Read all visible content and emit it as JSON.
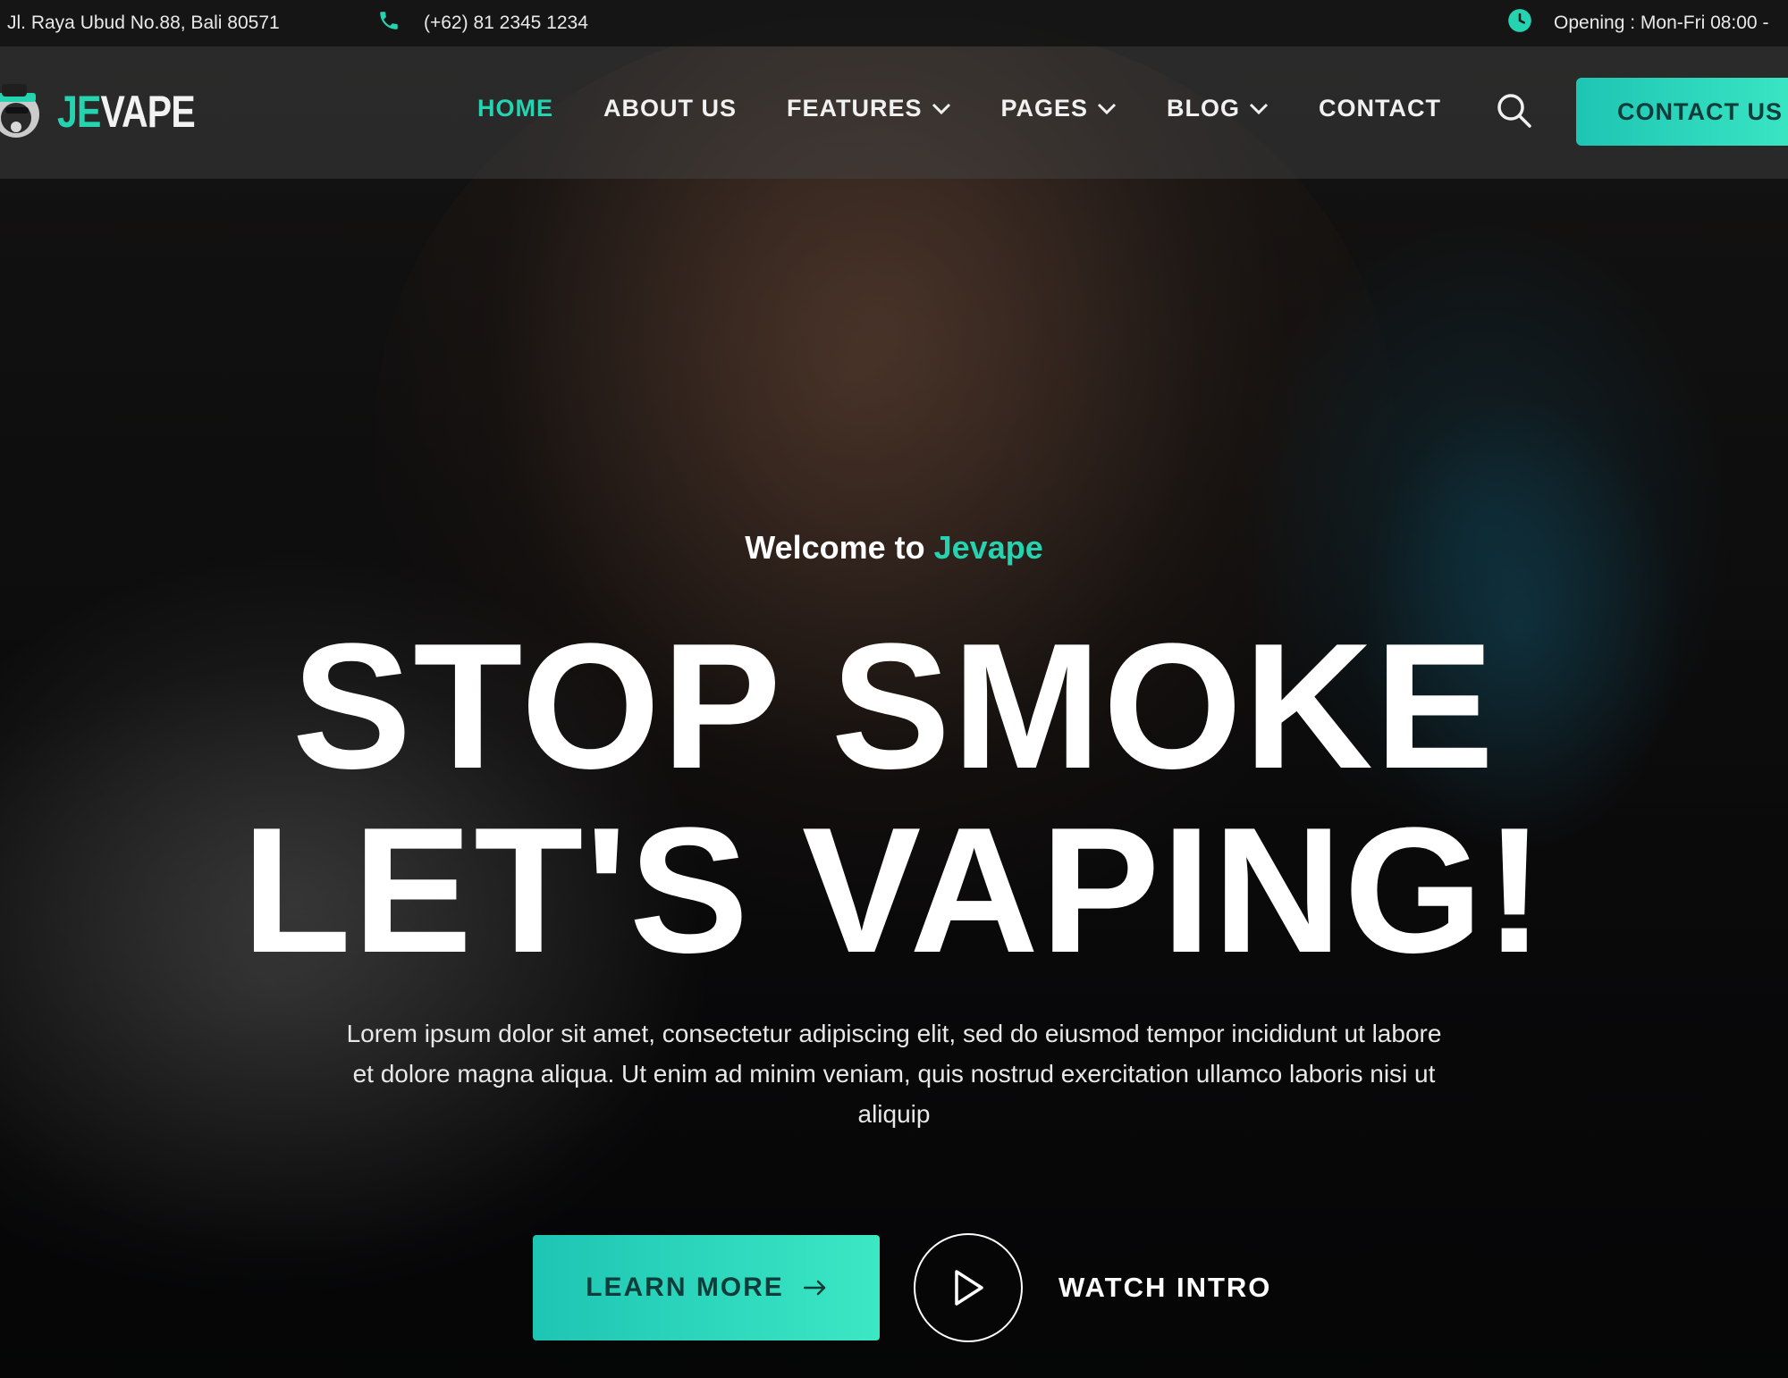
{
  "topbar": {
    "address": "Jl. Raya Ubud No.88, Bali 80571",
    "phone": "(+62) 81 2345 1234",
    "hours": "Opening : Mon-Fri 08:00 -",
    "phone_icon": "phone-icon",
    "clock_icon": "clock-icon"
  },
  "nav": {
    "logo": {
      "accent": "JE",
      "rest": "VAPE"
    },
    "items": [
      {
        "label": "HOME",
        "active": true,
        "dropdown": false
      },
      {
        "label": "ABOUT US",
        "active": false,
        "dropdown": false
      },
      {
        "label": "FEATURES",
        "active": false,
        "dropdown": true
      },
      {
        "label": "PAGES",
        "active": false,
        "dropdown": true
      },
      {
        "label": "BLOG",
        "active": false,
        "dropdown": true
      },
      {
        "label": "CONTACT",
        "active": false,
        "dropdown": false
      }
    ],
    "search_icon": "search-icon",
    "cta_label": "CONTACT US"
  },
  "hero": {
    "welcome_prefix": "Welcome to",
    "welcome_brand": "Jevape",
    "headline_line1": "STOP SMOKE",
    "headline_line2": "LET'S VAPING!",
    "lead": "Lorem ipsum dolor sit amet, consectetur adipiscing elit, sed do eiusmod tempor incididunt ut labore et dolore magna aliqua. Ut enim ad minim veniam, quis nostrud exercitation ullamco laboris nisi ut aliquip",
    "learn_more_label": "LEARN MORE",
    "watch_label": "WATCH INTRO"
  },
  "colors": {
    "accent": "#25d3b0",
    "button_gradient_start": "#1ec5b4",
    "button_gradient_end": "#3be8c4",
    "button_text": "#0d3d3a",
    "topbar_bg": "#161616"
  }
}
